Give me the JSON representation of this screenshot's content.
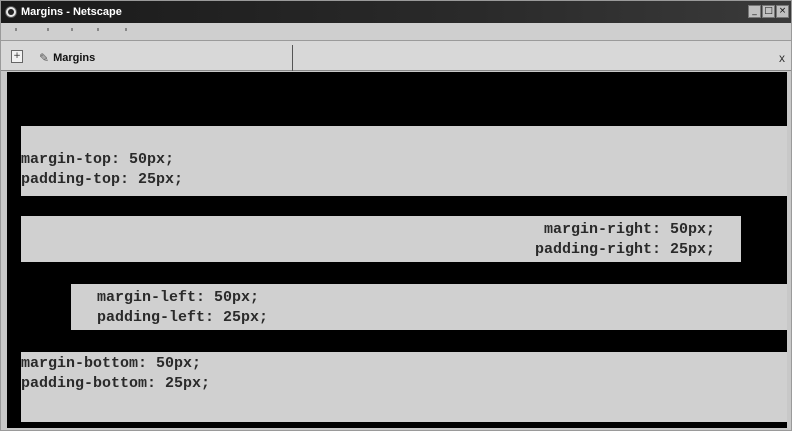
{
  "window": {
    "title": "Margins - Netscape",
    "controls": {
      "minimize": "_",
      "maximize": "□",
      "close": "×"
    }
  },
  "tabbar": {
    "new_tab_icon": "new-tab-icon",
    "tabs": [
      {
        "label": "Margins",
        "icon": "page-icon"
      }
    ],
    "close_label": "x"
  },
  "content": {
    "boxes": [
      {
        "line1": "margin-top: 50px;",
        "line2": "padding-top: 25px;"
      },
      {
        "line1": "margin-right: 50px;",
        "line2": "padding-right: 25px;"
      },
      {
        "line1": "margin-left: 50px;",
        "line2": "padding-left: 25px;"
      },
      {
        "line1": "margin-bottom: 50px;",
        "line2": "padding-bottom: 25px;"
      }
    ]
  },
  "colors": {
    "page_background": "#000000",
    "box_background": "#d0d0d0",
    "text": "#2a2a2a"
  }
}
